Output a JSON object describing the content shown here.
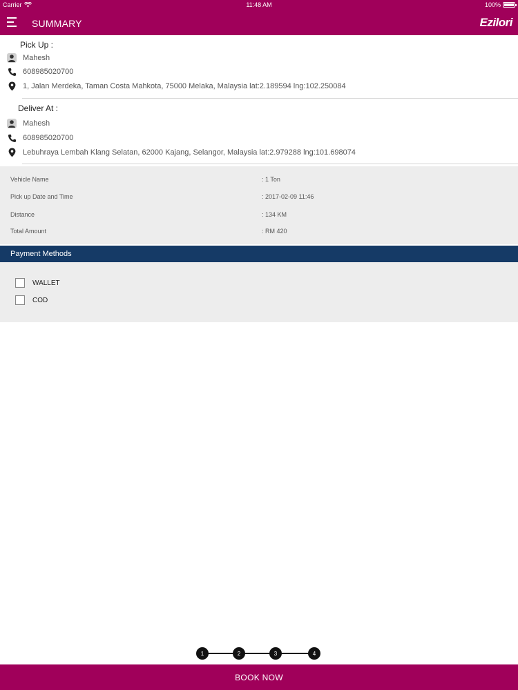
{
  "status_bar": {
    "carrier": "Carrier",
    "time": "11:48 AM",
    "battery": "100%"
  },
  "header": {
    "title": "SUMMARY",
    "brand": "Ezilori"
  },
  "pickup": {
    "heading": "Pick Up :",
    "name": "Mahesh",
    "phone": "608985020700",
    "address": "1, Jalan Merdeka, Taman Costa Mahkota, 75000 Melaka, Malaysia lat:2.189594 lng:102.250084"
  },
  "delivery": {
    "heading": "Deliver At :",
    "name": "Mahesh",
    "phone": "608985020700",
    "address": "Lebuhraya Lembah Klang Selatan, 62000 Kajang, Selangor, Malaysia lat:2.979288 lng:101.698074"
  },
  "details": [
    {
      "label": "Vehicle Name",
      "value": ": 1 Ton"
    },
    {
      "label": "Pick up Date and Time",
      "value": ": 2017-02-09 11:46"
    },
    {
      "label": "Distance",
      "value": ": 134 KM"
    },
    {
      "label": "Total Amount",
      "value": ": RM 420"
    }
  ],
  "payment": {
    "heading": "Payment Methods",
    "options": [
      {
        "label": "WALLET",
        "checked": false
      },
      {
        "label": "COD",
        "checked": false
      }
    ]
  },
  "stepper": {
    "steps": [
      "1",
      "2",
      "3",
      "4"
    ]
  },
  "footer": {
    "book_label": "BOOK NOW"
  },
  "colors": {
    "brand": "#a0005a",
    "payment_header": "#153a66",
    "panel": "#ededed"
  },
  "icons": {
    "menu": "menu-icon",
    "person": "person-icon",
    "phone": "phone-icon",
    "location": "location-pin-icon",
    "wifi": "wifi-icon",
    "battery": "battery-icon"
  }
}
